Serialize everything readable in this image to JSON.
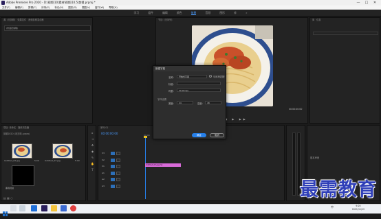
{
  "window": {
    "title": "Adobe Premiere Pro 2020 - D:\\视频\\10\\素材\\视频\\10.5\\剪辑.prproj *",
    "controls": [
      "—",
      "□",
      "✕"
    ]
  },
  "menu": [
    "文件(F)",
    "编辑(E)",
    "剪辑(C)",
    "序列(S)",
    "标记(M)",
    "图形(G)",
    "视图(V)",
    "窗口(W)",
    "帮助(H)"
  ],
  "workspace": {
    "items": [
      "学习",
      "组件",
      "编辑",
      "颜色",
      "效果",
      "音频",
      "图形",
      "库"
    ],
    "active_index": 4
  },
  "source_panel": {
    "tabs": [
      "源: (无剪辑)",
      "效果控件",
      "音频剪辑混合器",
      "元数据"
    ],
    "placeholder": "(未选定剪辑)"
  },
  "program_panel": {
    "tab": "节目: (无序列)",
    "timecode_left": "00:00:00:00",
    "timecode_right": "00:00:00:00"
  },
  "right_panel": {
    "tabs": [
      "库",
      "信息"
    ],
    "bottom_label": "基本声音"
  },
  "project_panel": {
    "tabs": [
      "项目: 未命名",
      "媒体浏览器",
      "库"
    ],
    "path": "剪辑2020 (未五年).prproj",
    "items": [
      {
        "name": "Untitled_02.jpg",
        "duration": "5:00",
        "color": "#e7c58a"
      },
      {
        "name": "Untitled_03.jpg",
        "duration": "5:00",
        "color": "#e7c58a"
      },
      {
        "name": "黑场视频",
        "duration": "5:00",
        "color": "#000000"
      }
    ]
  },
  "timeline": {
    "tab": "序列 01",
    "timecode": "00:00:00:00",
    "ruler": [
      "00:00",
      "00:00:05:00"
    ],
    "clip_label": "Untitled_03.jpg [V]",
    "clip_color": "#d86bd8",
    "tracks": [
      "V3",
      "V2",
      "V1",
      "A1",
      "A2",
      "A3"
    ]
  },
  "dialog": {
    "title": "新建字幕",
    "name_label": "名称:",
    "name_value": "开放式字幕",
    "checkbox_label": "与序列匹配",
    "style_label": "标准:",
    "time_label": "时基:",
    "time_value": "30.00 fps",
    "section": "字体设置",
    "width_label": "宽度:",
    "width_value": "24",
    "height_label": "高度:",
    "height_value": "48",
    "ok": "确定",
    "cancel": "取消"
  },
  "taskbar": {
    "search_placeholder": "在这里输入你要搜索的内容",
    "time": "9:20",
    "date": "2021/11/12",
    "input_method": "中"
  },
  "watermark": "最需教育",
  "colors": {
    "accent": "#2680eb",
    "watermark": "#2f3fb8",
    "clip": "#d86bd8"
  }
}
